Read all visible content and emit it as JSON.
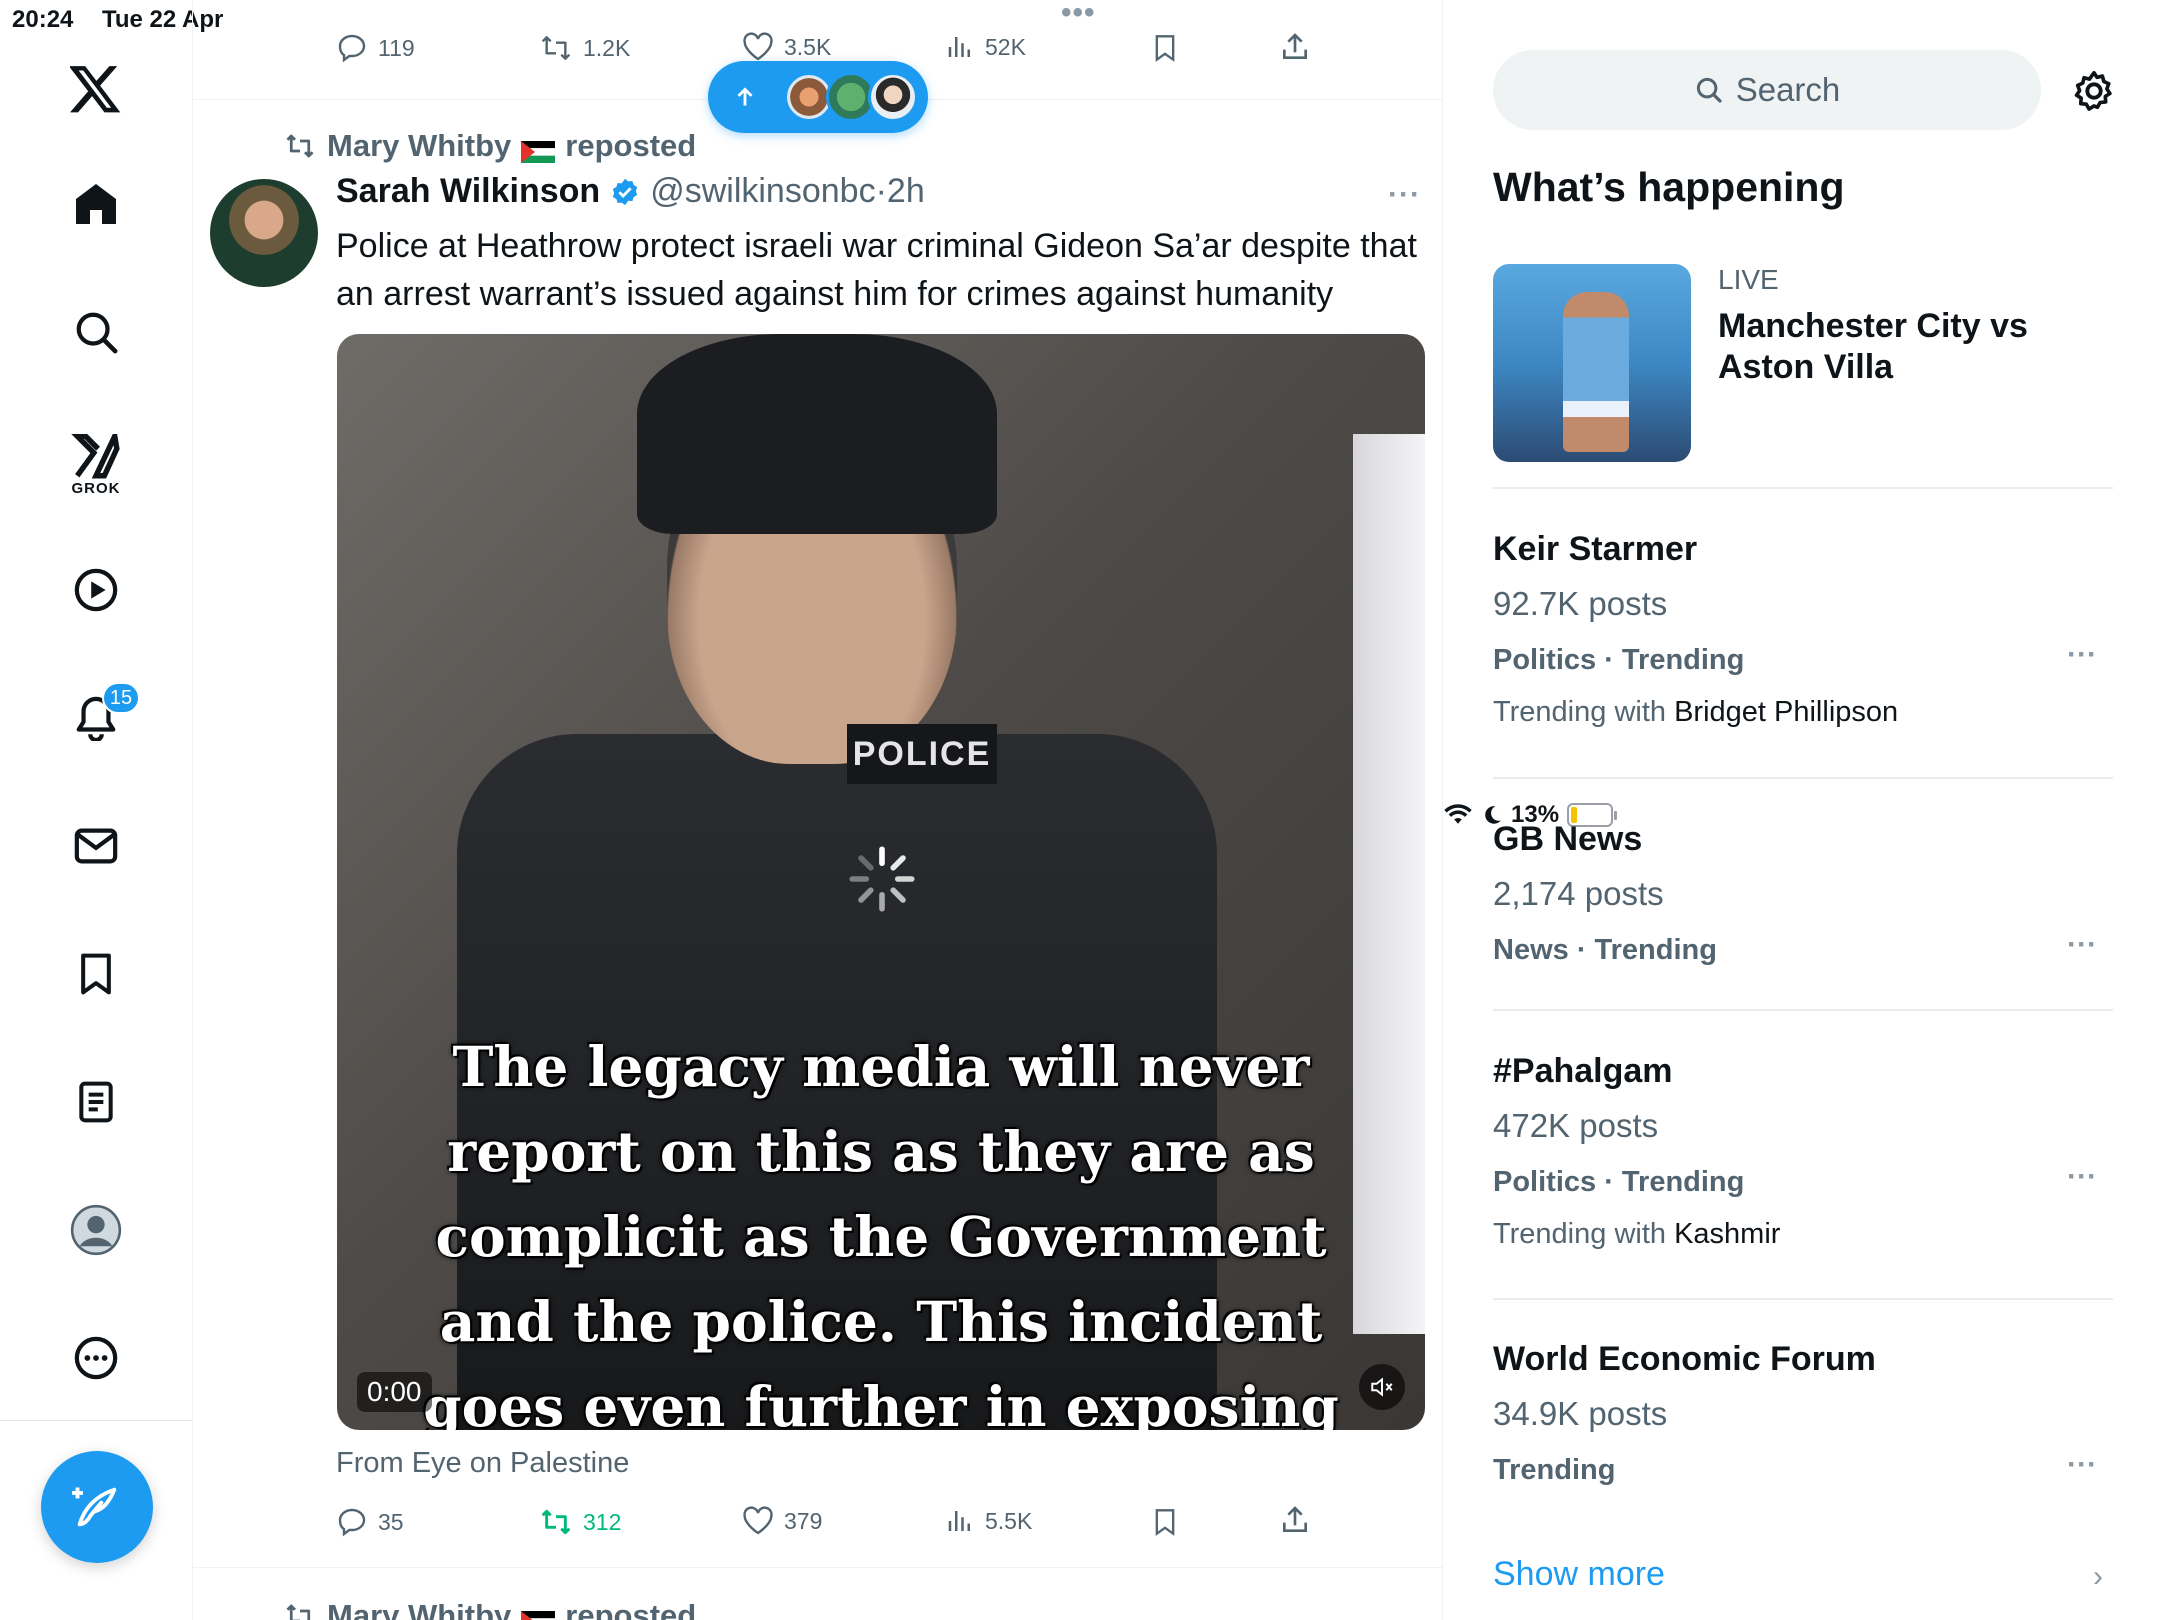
{
  "status_bar": {
    "time": "20:24",
    "date": "Tue 22 Apr",
    "battery": "13%"
  },
  "nav": {
    "grok_label": "GROK",
    "notifications_badge": "15",
    "items": [
      "x-logo",
      "home-icon",
      "search-icon",
      "grok-icon",
      "video-icon",
      "notifications-icon",
      "messages-icon",
      "bookmarks-icon",
      "lists-icon",
      "profile-icon",
      "more-icon"
    ]
  },
  "feed": {
    "prev_post_stats": {
      "replies": "119",
      "reposts": "1.2K",
      "likes": "3.5K",
      "views": "52K"
    },
    "tweet": {
      "reposted_by": "Mary Whitby",
      "reposted_suffix": "reposted",
      "author_name": "Sarah Wilkinson",
      "handle": "@swilkinsonbc",
      "time_sep": "·",
      "time": "2h",
      "text": "Police at Heathrow protect israeli war criminal Gideon Sa’ar despite that an arrest warrant’s issued against him for crimes against humanity",
      "video": {
        "patch_text": "POLICE",
        "caption_lines": [
          "The legacy media will never",
          "report on this as they are as",
          "complicit as the Government",
          "and the police. This incident",
          "goes even further in exposing"
        ],
        "timecode": "0:00"
      },
      "source": "From Eye on Palestine",
      "stats": {
        "replies": "35",
        "reposts": "312",
        "likes": "379",
        "views": "5.5K"
      }
    },
    "next_reposted_by": "Mary Whitby",
    "next_reposted_suffix": "reposted"
  },
  "sidebar": {
    "search_placeholder": "Search",
    "section_title": "What’s happening",
    "live": {
      "label": "LIVE",
      "title": "Manchester City vs Aston Villa"
    },
    "trends": [
      {
        "topic": "Keir Starmer",
        "count": "92.7K posts",
        "category": "Politics · Trending",
        "with_prefix": "Trending with",
        "with": "Bridget Phillipson"
      },
      {
        "topic": "GB News",
        "count": "2,174 posts",
        "category": "News · Trending",
        "with_prefix": "",
        "with": ""
      },
      {
        "topic": "#Pahalgam",
        "count": "472K posts",
        "category": "Politics · Trending",
        "with_prefix": "Trending with",
        "with": "Kashmir"
      },
      {
        "topic": "World Economic Forum",
        "count": "34.9K posts",
        "category": "Trending",
        "with_prefix": "",
        "with": ""
      }
    ],
    "show_more": "Show more"
  },
  "colors": {
    "accent": "#1d9bf0",
    "repost_active": "#00ba7c",
    "muted": "#536471"
  }
}
